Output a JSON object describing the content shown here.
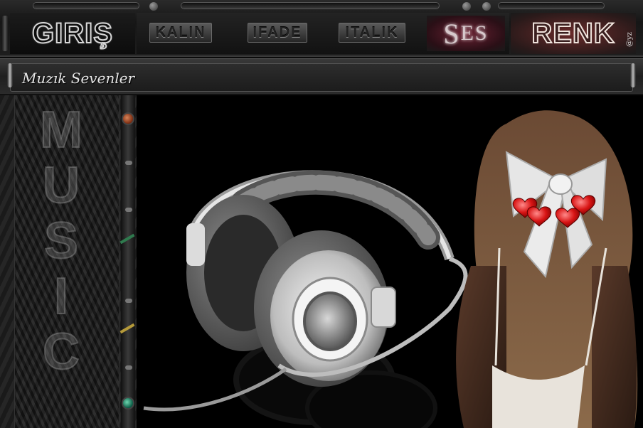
{
  "header": {
    "logo": "GIRIŞ",
    "buttons": [
      {
        "label": "KALIN"
      },
      {
        "label": "IFADE"
      },
      {
        "label": "ITALIK"
      }
    ],
    "ses_first": "S",
    "ses_rest": "ES",
    "color_label": "RENK",
    "credit": "@yz"
  },
  "title_bar": {
    "title": "Muzık Sevenler"
  },
  "sidebar": {
    "letters": [
      "M",
      "U",
      "S",
      "I",
      "C"
    ]
  },
  "colors": {
    "accent": "#c51b1b",
    "lamp_top": "#b4552a",
    "lamp_bottom": "#1c8a68"
  }
}
